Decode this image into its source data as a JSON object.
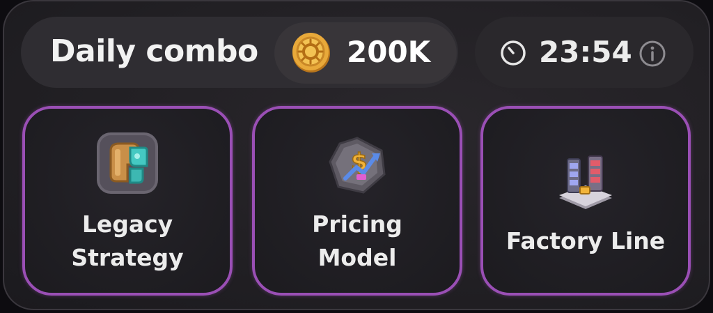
{
  "header": {
    "title": "Daily combo",
    "reward_amount": "200K",
    "reward_icon": "coin-icon",
    "timer": "23:54",
    "timer_icon": "clock-icon",
    "info_icon": "info-icon"
  },
  "cards": [
    {
      "label": "Legacy\nStrategy",
      "icon": "legacy-strategy-icon"
    },
    {
      "label": "Pricing\nModel",
      "icon": "pricing-model-icon"
    },
    {
      "label": "Factory Line",
      "icon": "factory-line-icon"
    }
  ],
  "colors": {
    "card_border": "#9a4fb5",
    "coin": "#e8a93a",
    "panel": "#222024"
  }
}
